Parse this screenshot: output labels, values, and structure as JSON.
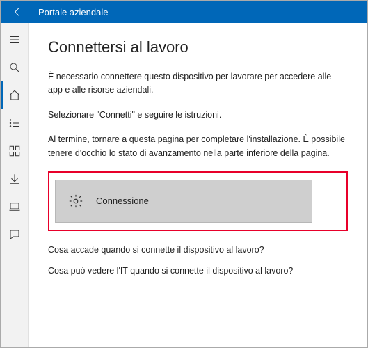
{
  "titlebar": {
    "title": "Portale aziendale"
  },
  "sidebar": {
    "items": [
      {
        "name": "menu"
      },
      {
        "name": "search"
      },
      {
        "name": "home"
      },
      {
        "name": "list"
      },
      {
        "name": "apps"
      },
      {
        "name": "downloads"
      },
      {
        "name": "device"
      },
      {
        "name": "help"
      }
    ]
  },
  "page": {
    "heading": "Connettersi al lavoro",
    "p1": "È necessario connettere questo dispositivo per lavorare per accedere alle app e alle risorse aziendali.",
    "p2": "Selezionare \"Connetti\" e seguire le istruzioni.",
    "p3": "Al termine, tornare a questa pagina per completare l'installazione. È possibile tenere d'occhio lo stato di avanzamento nella parte inferiore della pagina.",
    "connect_label": "Connessione",
    "link1": "Cosa accade quando si connette il dispositivo al lavoro?",
    "link2": "Cosa può vedere l'IT quando si connette il dispositivo al lavoro?"
  }
}
